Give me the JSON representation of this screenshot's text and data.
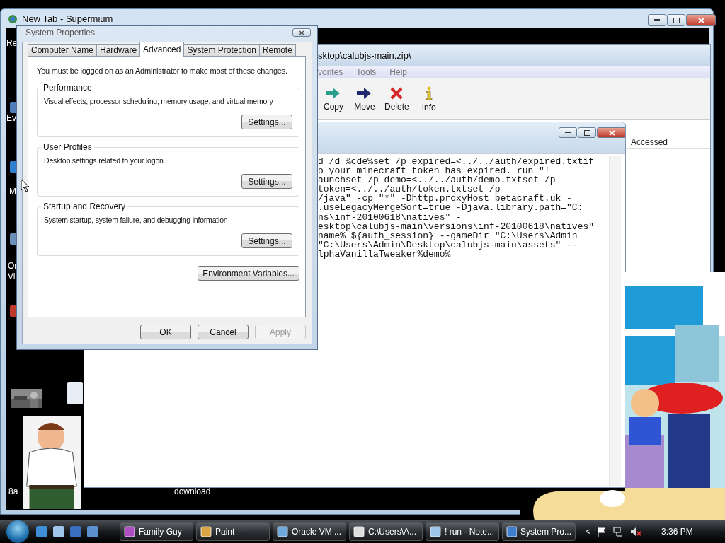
{
  "browser": {
    "title": "New Tab - Supermium"
  },
  "desktop_icons": [
    {
      "label": "Re"
    },
    {
      "label": "Ev"
    },
    {
      "label": "M"
    },
    {
      "label": "Or"
    },
    {
      "label": "Vi"
    },
    {
      "label": "8a"
    },
    {
      "label": "download"
    }
  ],
  "archive_window": {
    "title": "sktop\\calubjs-main.zip\\",
    "menu": [
      "vorites",
      "Tools",
      "Help"
    ],
    "toolbar": [
      {
        "kind": "copy",
        "label": "Copy"
      },
      {
        "kind": "move",
        "label": "Move"
      },
      {
        "kind": "delete",
        "label": "Delete"
      },
      {
        "kind": "info",
        "label": "Info"
      }
    ],
    "columns": [
      "Accessed"
    ]
  },
  "notepad": {
    "lines": [
      "d /d %cde%set /p expired=<../../auth/expired.txtif",
      "o your minecraft token has expired. run \"!",
      "aunchset /p demo=<../../auth/demo.txtset /p",
      "token=<../../auth/token.txtset /p",
      "/java\" -cp \"*\" -Dhttp.proxyHost=betacraft.uk -",
      ".useLegacyMergeSort=true -Djava.library.path=\"C:",
      "ns\\inf-20100618\\natives\" -",
      "esktop\\calubjs-main\\versions\\inf-20100618\\natives\"",
      "name% ${auth_session} --gameDir \"C:\\Users\\Admin",
      "\"C:\\Users\\Admin\\Desktop\\calubjs-main\\assets\" --",
      "lphaVanillaTweaker%demo%"
    ]
  },
  "dialog": {
    "title": "System Properties",
    "tabs": [
      {
        "label": "Computer Name",
        "selected": false
      },
      {
        "label": "Hardware",
        "selected": false
      },
      {
        "label": "Advanced",
        "selected": true
      },
      {
        "label": "System Protection",
        "selected": false
      },
      {
        "label": "Remote",
        "selected": false
      }
    ],
    "notice": "You must be logged on as an Administrator to make most of these changes.",
    "groups": [
      {
        "title": "Performance",
        "description": "Visual effects, processor scheduling, memory usage, and virtual memory",
        "button": "Settings..."
      },
      {
        "title": "User Profiles",
        "description": "Desktop settings related to your logon",
        "button": "Settings..."
      },
      {
        "title": "Startup and Recovery",
        "description": "System startup, system failure, and debugging information",
        "button": "Settings..."
      }
    ],
    "env_button": "Environment Variables...",
    "buttons": [
      {
        "label": "OK",
        "disabled": false
      },
      {
        "label": "Cancel",
        "disabled": false
      },
      {
        "label": "Apply",
        "disabled": true
      }
    ]
  },
  "taskbar": {
    "buttons": [
      {
        "kind": "picture",
        "label": "Family Guy"
      },
      {
        "kind": "paint",
        "label": "Paint"
      },
      {
        "kind": "vm",
        "label": "Oracle VM ..."
      },
      {
        "kind": "archive",
        "label": "C:\\Users\\A..."
      },
      {
        "kind": "notepad",
        "label": "! run - Note..."
      },
      {
        "kind": "system",
        "label": "System Pro..."
      }
    ],
    "tray_arrow": "<",
    "clock": "3:36 PM"
  }
}
